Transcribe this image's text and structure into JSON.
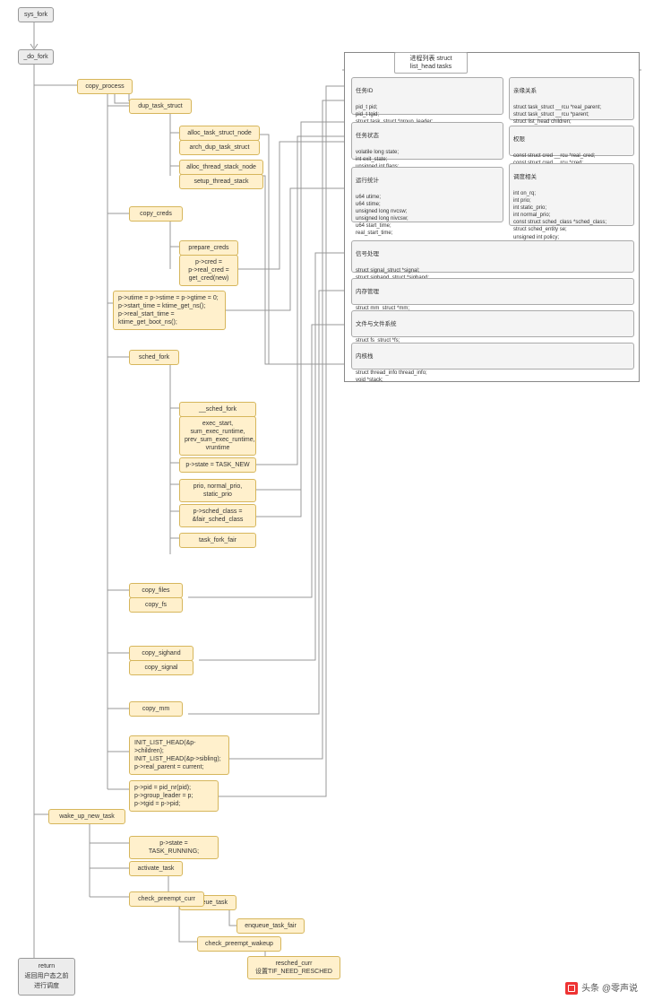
{
  "nodes": {
    "sys_fork": "sys_fork",
    "do_fork": "_do_fork",
    "copy_process": "copy_process",
    "dup_task_struct": "dup_task_struct",
    "alloc_task_struct_node": "alloc_task_struct_node",
    "arch_dup_task_struct": "arch_dup_task_struct",
    "alloc_thread_stack_node": "alloc_thread_stack_node",
    "setup_thread_stack": "setup_thread_stack",
    "copy_creds": "copy_creds",
    "prepare_creds": "prepare_creds",
    "cred_block": "p->cred =\np->real_cred =\nget_cred(new)",
    "time_block": "p->utime = p->stime = p->gtime = 0;\np->start_time = ktime_get_ns();\np->real_start_time =\nktime_get_boot_ns();",
    "sched_fork": "sched_fork",
    "__sched_fork": "__sched_fork",
    "sched_fork_body": "exec_start,\nsum_exec_runtime,\nprev_sum_exec_runtime,\nvruntime",
    "state_task_new": "p->state = TASK_NEW",
    "prio_block": "prio,  normal_prio,\nstatic_prio",
    "sched_class_block": "p->sched_class =\n&fair_sched_class",
    "task_fork_fair": "task_fork_fair",
    "copy_files": "copy_files",
    "copy_fs": "copy_fs",
    "copy_sighand": "copy_sighand",
    "copy_signal": "copy_signal",
    "copy_mm": "copy_mm",
    "init_list": "INIT_LIST_HEAD(&p-\n>children);\nINIT_LIST_HEAD(&p->sibling);\np->real_parent = current;",
    "pid_block": "p->pid = pid_nr(pid);\np->group_leader = p;\np->tgid = p->pid;",
    "wake_up_new_task": "wake_up_new_task",
    "state_running": "p->state = TASK_RUNNING;",
    "activate_task": "activate_task",
    "enqueue_task": "enqueue_task",
    "enqueue_task_fair": "enqueue_task_fair",
    "check_preempt_curr": "check_preempt_curr",
    "check_preempt_wakeup": "check_preempt_wakeup",
    "resched_curr": "resched_curr\n设置TIF_NEED_RESCHED",
    "return_block": "return\n返回用户态之前\n进行调度"
  },
  "struct": {
    "title": "进程列表\nstruct list_head tasks",
    "task_id": {
      "hdr": "任务ID",
      "body": "pid_t pid;\npid_t tgid;\nstruct task_struct *group_leader;"
    },
    "relation": {
      "hdr": "亲缘关系",
      "body": "struct task_struct __rcu *real_parent;\nstruct task_struct __rcu *parent;\nstruct list_head children;\nstruct list_head sibling;"
    },
    "task_state": {
      "hdr": "任务状态",
      "body": "volatile long state;\nint exit_state;\nunsigned int flags;"
    },
    "perm": {
      "hdr": "权限",
      "body": "const struct cred __rcu *real_cred;\nconst struct cred __rcu *cred;"
    },
    "stats": {
      "hdr": "运行统计",
      "body": "u64 utime;\nu64 stime;\nunsigned long nvcsw;\nunsigned long nivcsw;\nu64 start_time;\nreal_start_time;"
    },
    "sched": {
      "hdr": "调度相关",
      "body": "int on_rq;\nint prio;\nint static_prio;\nint normal_prio;\nconst struct sched_class *sched_class;\nstruct sched_entity se;\nunsigned int policy;"
    },
    "signal": {
      "hdr": "信号处理",
      "body": "struct signal_struct *signal;\nstruct sighand_struct *sighand;\nstruct sigpending pending;"
    },
    "mm": {
      "hdr": "内存管理",
      "body": "struct mm_struct *mm;\nstruct mm_struct *active_mm;"
    },
    "fs": {
      "hdr": "文件与文件系统",
      "body": "struct fs_struct *fs;\nstruct files_struct *files;"
    },
    "stack": {
      "hdr": "内核栈",
      "body": "struct thread_info thread_info;\nvoid *stack;"
    }
  },
  "watermark": "头条 @零声说"
}
